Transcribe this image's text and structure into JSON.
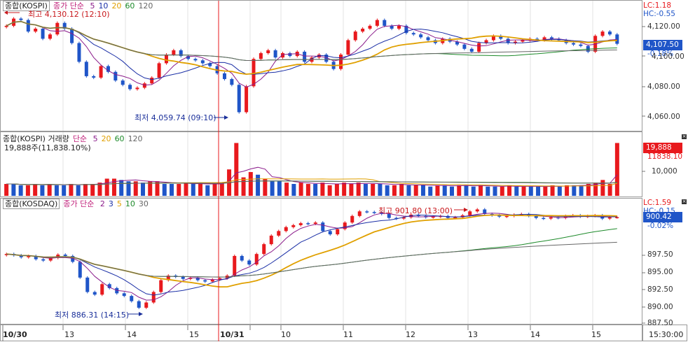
{
  "panels": {
    "kospi": {
      "title": "종합(KOSPI)",
      "indicator": "종가 단순",
      "periods": [
        {
          "label": "5",
          "color": "#8b1c8b"
        },
        {
          "label": "10",
          "color": "#1b2fa6"
        },
        {
          "label": "20",
          "color": "#e0a000"
        },
        {
          "label": "60",
          "color": "#1d8a2a"
        },
        {
          "label": "120",
          "color": "#666666"
        }
      ],
      "high_label": "최고 4,130.12 (12:10)",
      "low_label": "최저 4,059.74 (09:10)",
      "lc": "LC:1.18",
      "hc": "HC:-0.55",
      "current_price": "4,107.50",
      "change_pct": "-0.18%",
      "y_ticks": [
        "4,120.00",
        "4,100.00",
        "4,080.00",
        "4,060.00"
      ],
      "y_range": [
        4050,
        4135
      ]
    },
    "volume": {
      "title": "종합(KOSPI) 거래량",
      "indicator": "단순",
      "periods": [
        {
          "label": "5",
          "color": "#8b1c8b"
        },
        {
          "label": "20",
          "color": "#e0a000"
        },
        {
          "label": "60",
          "color": "#1d8a2a"
        },
        {
          "label": "120",
          "color": "#666666"
        }
      ],
      "readout": "19,888주(11,838.10%)",
      "current_value": "19,888",
      "current_sub": "11838.10",
      "y_ticks": [
        "10,000"
      ]
    },
    "kosdaq": {
      "title": "종합(KOSDAQ)",
      "indicator": "종가 단순",
      "periods": [
        {
          "label": "2",
          "color": "#8b1c8b"
        },
        {
          "label": "3",
          "color": "#1b2fa6"
        },
        {
          "label": "5",
          "color": "#e0a000"
        },
        {
          "label": "10",
          "color": "#1d8a2a"
        },
        {
          "label": "30",
          "color": "#666666"
        }
      ],
      "high_label": "최고 901.80 (13:00)",
      "low_label": "최저 886.31 (14:15)",
      "lc": "LC:1.59",
      "hc": "HC:-0.15",
      "current_price": "900.42",
      "change_pct": "-0.02%",
      "y_ticks": [
        "897.50",
        "895.00",
        "892.50",
        "890.00",
        "887.50"
      ],
      "y_range": [
        885,
        902.5
      ]
    }
  },
  "x_axis": {
    "labels": [
      "10/30",
      "13",
      "14",
      "15",
      "10/31",
      "10",
      "11",
      "12",
      "13",
      "14",
      "15"
    ],
    "time": "15:30:00"
  },
  "colors": {
    "up": "#e8191d",
    "down": "#1f55c8",
    "current_box": "#1f55c8",
    "volume_box": "#e8191d",
    "session_line": "#e8191d",
    "grid": "#e3e3e3"
  },
  "chart_data": [
    {
      "type": "candlestick",
      "title": "종합(KOSPI)",
      "xlabel": "",
      "ylabel": "",
      "ylim": [
        4050,
        4135
      ],
      "grid": true,
      "closes": [
        4120,
        4125,
        4124,
        4116,
        4118,
        4111,
        4114,
        4122,
        4118,
        4108,
        4095,
        4085,
        4084,
        4092,
        4088,
        4082,
        4079,
        4076,
        4077,
        4080,
        4084,
        4094,
        4100,
        4103,
        4099,
        4097,
        4096,
        4094,
        4092,
        4087,
        4083,
        4079,
        4060,
        4078,
        4097,
        4101,
        4103,
        4098,
        4101,
        4099,
        4102,
        4095,
        4098,
        4100,
        4095,
        4090,
        4100,
        4110,
        4116,
        4118,
        4120,
        4124,
        4120,
        4118,
        4120,
        4115,
        4114,
        4112,
        4110,
        4108,
        4111,
        4109,
        4107,
        4104,
        4102,
        4108,
        4110,
        4113,
        4111,
        4108,
        4109,
        4110,
        4111,
        4110,
        4112,
        4111,
        4110,
        4108,
        4107,
        4106,
        4102,
        4113,
        4116,
        4114,
        4107.5
      ],
      "highs_annotation": {
        "value": 4130.12,
        "time": "12:10"
      },
      "lows_annotation": {
        "value": 4059.74,
        "time": "09:10"
      }
    },
    {
      "type": "bar",
      "title": "종합(KOSPI) 거래량",
      "xlabel": "",
      "ylabel": "",
      "values": [
        9,
        9,
        8,
        8,
        9,
        8,
        9,
        8,
        8,
        9,
        8,
        9,
        9,
        10,
        13,
        13,
        12,
        11,
        11,
        10,
        11,
        11,
        9,
        9,
        9,
        10,
        9,
        9,
        8,
        9,
        10,
        20,
        40,
        14,
        18,
        16,
        13,
        11,
        11,
        10,
        9,
        10,
        9,
        9,
        10,
        8,
        9,
        10,
        9,
        10,
        9,
        9,
        9,
        8,
        8,
        9,
        8,
        8,
        8,
        7,
        8,
        8,
        7,
        8,
        8,
        7,
        8,
        7,
        7,
        7,
        8,
        7,
        7,
        7,
        7,
        7,
        8,
        7,
        8,
        8,
        8,
        9,
        10,
        12,
        9,
        40
      ],
      "ylim": [
        0,
        45
      ]
    },
    {
      "type": "candlestick",
      "title": "종합(KOSDAQ)",
      "xlabel": "",
      "ylabel": "",
      "ylim": [
        885,
        902.5
      ],
      "grid": true,
      "closes": [
        894.8,
        894.6,
        894.3,
        894.5,
        894,
        893.8,
        894.2,
        894.7,
        894.5,
        893.6,
        891.2,
        889,
        888.6,
        890.2,
        889.6,
        888.8,
        888.4,
        887.6,
        886.6,
        887.4,
        889,
        890.8,
        891.5,
        891.3,
        891,
        891.2,
        890.8,
        890.6,
        890.9,
        891.1,
        891.5,
        894.5,
        893.8,
        893.2,
        894.8,
        896.3,
        897.6,
        898.3,
        898.9,
        899.2,
        899.5,
        899.4,
        899.6,
        898.3,
        897.8,
        898.6,
        899.6,
        900.6,
        901.3,
        901.2,
        901.1,
        900.9,
        900.3,
        900.2,
        900.4,
        900.8,
        900.6,
        900.4,
        900.5,
        900.6,
        900.3,
        900.4,
        900.7,
        901.3,
        901.6,
        900.9,
        900.7,
        900.5,
        900.6,
        900.8,
        900.9,
        900.6,
        900.3,
        900.2,
        900.4,
        900.3,
        900.6,
        900.7,
        900.5,
        900.6,
        900.7,
        900.2,
        900.4,
        900.42
      ],
      "highs_annotation": {
        "value": 901.8,
        "time": "13:00"
      },
      "lows_annotation": {
        "value": 886.31,
        "time": "14:15"
      }
    }
  ]
}
